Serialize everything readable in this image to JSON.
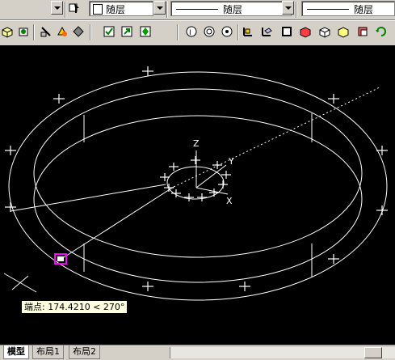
{
  "toolbar_top": {
    "layer_combo_label": "随层",
    "linetype_combo_label": "随层",
    "lineweight_combo_label": "随层"
  },
  "toolbar_bottom": {
    "icons": [
      "view-3d-icon",
      "view-orbit-icon",
      "shade-icon",
      "paint-icon",
      "flat-shade-icon",
      "check-icon",
      "export-icon",
      "gouraud-icon",
      "circle-a-icon",
      "circle-b-icon",
      "circle-c-icon",
      "ucs-icon",
      "ucs-3d-icon",
      "box-icon",
      "box-red-icon",
      "box-outline-icon",
      "box-yellow-icon",
      "box-red2-icon",
      "refresh-icon"
    ]
  },
  "canvas": {
    "axes": {
      "z_label": "Z",
      "y_label": "Y",
      "x_label": "X"
    }
  },
  "tooltip": {
    "text": "端点: 174.4210 < 270°"
  },
  "tabs": [
    {
      "label": "模型",
      "active": true
    },
    {
      "label": "布局1",
      "active": false
    },
    {
      "label": "布局2",
      "active": false
    }
  ],
  "colors": {
    "canvas_bg": "#000000",
    "entity": "#ffffff",
    "grip": "#ffffff",
    "snap_marker": "#ff00ff",
    "tooltip_bg": "#ffffe1"
  }
}
